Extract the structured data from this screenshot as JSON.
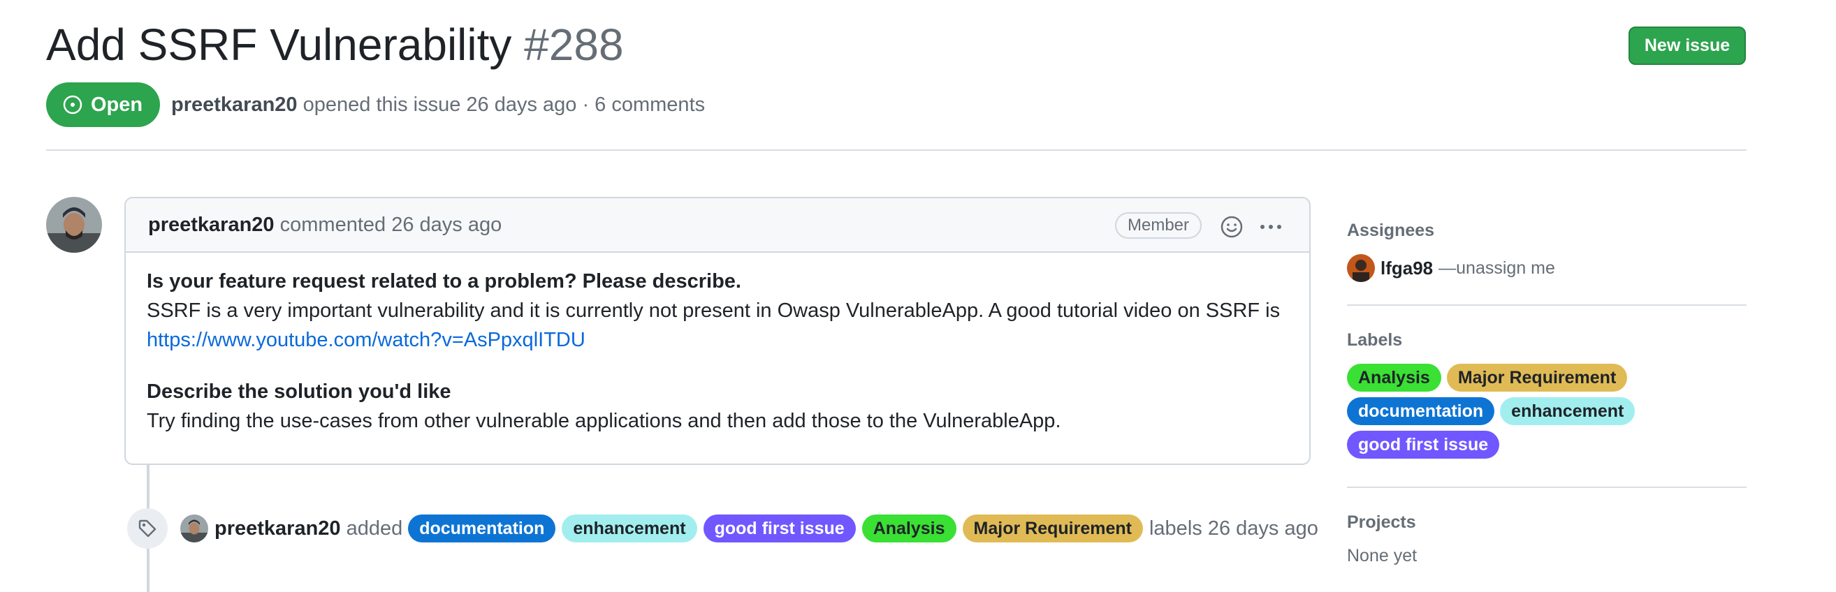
{
  "issue": {
    "title": "Add SSRF Vulnerability",
    "number": "#288",
    "state": "Open",
    "author": "preetkaran20",
    "opened_text": "opened this issue 26 days ago · 6 comments"
  },
  "header": {
    "new_issue_label": "New issue"
  },
  "comment": {
    "author": "preetkaran20",
    "meta": "commented 26 days ago",
    "role_badge": "Member",
    "heading1": "Is your feature request related to a problem? Please describe.",
    "para1": "SSRF is a very important vulnerability and it is currently not present in Owasp VulnerableApp. A good tutorial video on SSRF is",
    "link": "https://www.youtube.com/watch?v=AsPpxqlITDU",
    "heading2": "Describe the solution you'd like",
    "para2": "Try finding the use-cases from other vulnerable applications and then add those to the VulnerableApp."
  },
  "event": {
    "actor": "preetkaran20",
    "verb": "added",
    "labels": [
      {
        "name": "documentation",
        "bg": "#0e74d4",
        "fg": "#ffffff"
      },
      {
        "name": "enhancement",
        "bg": "#a2eeef",
        "fg": "#1f2328"
      },
      {
        "name": "good first issue",
        "bg": "#7057ff",
        "fg": "#ffffff"
      },
      {
        "name": "Analysis",
        "bg": "#3ae034",
        "fg": "#1f2328"
      },
      {
        "name": "Major Requirement",
        "bg": "#e0bb55",
        "fg": "#1f2328"
      }
    ],
    "suffix": "labels 26 days ago"
  },
  "sidebar": {
    "assignees_heading": "Assignees",
    "assignee": "lfga98",
    "unassign": "—unassign me",
    "labels_heading": "Labels",
    "labels": [
      {
        "name": "Analysis",
        "bg": "#3ae034",
        "fg": "#1f2328"
      },
      {
        "name": "Major Requirement",
        "bg": "#e0bb55",
        "fg": "#1f2328"
      },
      {
        "name": "documentation",
        "bg": "#0e74d4",
        "fg": "#ffffff"
      },
      {
        "name": "enhancement",
        "bg": "#a2eeef",
        "fg": "#1f2328"
      },
      {
        "name": "good first issue",
        "bg": "#7057ff",
        "fg": "#ffffff"
      }
    ],
    "projects_heading": "Projects",
    "projects_value": "None yet"
  }
}
